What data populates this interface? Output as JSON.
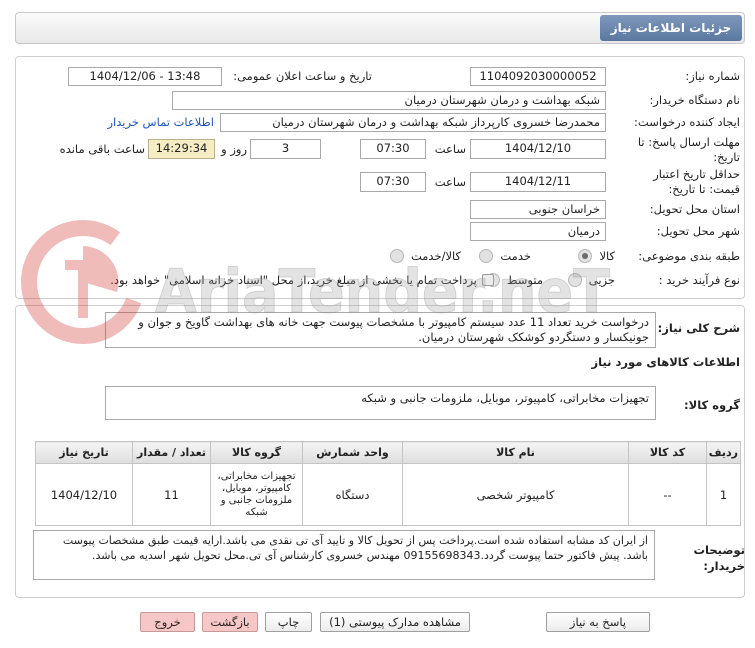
{
  "header": {
    "title": "جزئیات اطلاعات نیاز"
  },
  "form": {
    "need_number": {
      "label": "شماره نیاز:",
      "value": "1104092030000052"
    },
    "announce_datetime": {
      "label": "تاریخ و ساعت اعلان عمومی:",
      "value": "1404/12/06 - 13:48"
    },
    "buyer_org": {
      "label": "نام دستگاه خریدار:",
      "value": "شبکه بهداشت و درمان شهرستان درمیان"
    },
    "requester": {
      "label": "ایجاد کننده درخواست:",
      "value": "محمدرضا خسروی کارپرداز شبکه بهداشت و درمان شهرستان درمیان",
      "contact_link": "اطلاعات تماس خریدار"
    },
    "reply_deadline": {
      "label_line1": "مهلت ارسال پاسخ: تا",
      "label_line2": "تاریخ:",
      "date": "1404/12/10",
      "time_label": "ساعت",
      "time": "07:30",
      "days": "3",
      "days_label": "روز و",
      "remaining_time": "14:29:34",
      "remaining_label": "ساعت باقی مانده"
    },
    "price_validity": {
      "label_line1": "حداقل تاریخ اعتبار",
      "label_line2": "قیمت: تا تاریخ:",
      "date": "1404/12/11",
      "time_label": "ساعت",
      "time": "07:30"
    },
    "delivery_province": {
      "label": "استان محل تحویل:",
      "value": "خراسان جنوبی"
    },
    "delivery_city": {
      "label": "شهر محل تحویل:",
      "value": "درمیان"
    },
    "category": {
      "label": "طبقه بندی موضوعی:",
      "options": [
        "کالا",
        "خدمت",
        "کالا/خدمت"
      ],
      "selected": "کالا"
    },
    "process_type": {
      "label": "نوع فرآیند خرید :",
      "options": [
        "جزیی",
        "متوسط"
      ],
      "selected": "",
      "treasury_label": "پرداخت تمام یا بخشی از مبلغ خرید،از محل \"اسناد خزانه اسلامی\" خواهد بود.",
      "treasury_checked": false
    }
  },
  "description": {
    "label": "شرح کلی نیاز:",
    "value": "درخواست خرید تعداد 11 عدد سیستم کامپیوتر با مشخصات پیوست جهت خانه های بهداشت گاویخ و جوان و جونیکسار و دستگردو کوشکک شهرستان درمیان."
  },
  "items_section_title": "اطلاعات کالاهای مورد نیاز",
  "goods_group": {
    "label": "گروه کالا:",
    "value": "تجهیزات مخابراتی، کامپیوتر، موبایل، ملزومات جانبی و شبکه"
  },
  "items_table": {
    "columns": [
      "ردیف",
      "کد کالا",
      "نام کالا",
      "واحد شمارش",
      "گروه کالا",
      "تعداد / مقدار",
      "تاریخ نیاز"
    ],
    "rows": [
      [
        "1",
        "--",
        "کامپیوتر شخصی",
        "دستگاه",
        "تجهیزات مخابراتی، کامپیوتر، موبایل، ملزومات جانبی و شبکه",
        "11",
        "1404/12/10"
      ]
    ]
  },
  "buyer_notes": {
    "label_line1": "توضیحات",
    "label_line2": "خریدار:",
    "value": "از ایران کد مشابه استفاده شده است.پرداخت پس از تحویل کالا و تایید آی تی نقدی می باشد.ارایه قیمت طبق مشخصات پیوست باشد. پیش فاکتور حتما پیوست گردد.09155698343 مهندس خسروی کارشناس آی تی.محل تحویل شهر اسدیه می باشد."
  },
  "buttons": {
    "reply": "پاسخ به نیاز",
    "view_attachments": "مشاهده مدارک پیوستی (1)",
    "print": "چاپ",
    "back": "بازگشت",
    "exit": "خروج"
  },
  "watermark": {
    "text": "AriaTender.neT"
  },
  "colors": {
    "link": "#1a56c7",
    "title_tab": "#5a789f",
    "remaining_time_box": "#f5eec4",
    "exit_back_buttons": "#f7c6c6",
    "watermark_logo": "#d0312d"
  }
}
